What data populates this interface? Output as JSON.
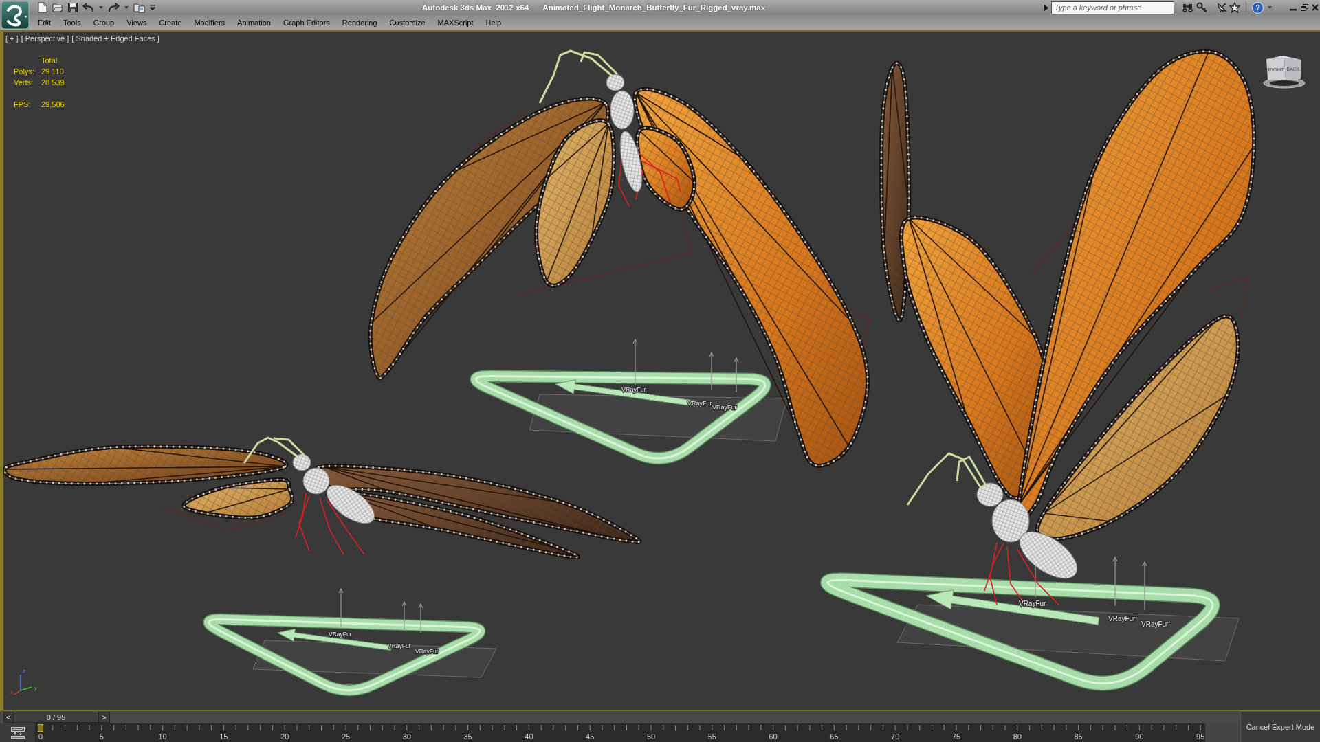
{
  "window": {
    "app_title": "Autodesk 3ds Max  2012 x64",
    "file_name": "Animated_Flight_Monarch_Butterfly_Fur_Rigged_vray.max"
  },
  "search": {
    "placeholder": "Type a keyword or phrase"
  },
  "help_button": "?",
  "menu": [
    "Edit",
    "Tools",
    "Group",
    "Views",
    "Create",
    "Modifiers",
    "Animation",
    "Graph Editors",
    "Rendering",
    "Customize",
    "MAXScript",
    "Help"
  ],
  "viewport": {
    "labels": [
      "[ + ]",
      "[ Perspective ]",
      "[ Shaded + Edged Faces ]"
    ],
    "stats": {
      "header": "Total",
      "rows": [
        {
          "label": "Polys:",
          "value": "29 110"
        },
        {
          "label": "Verts:",
          "value": "28 539"
        }
      ],
      "fps": {
        "label": "FPS:",
        "value": "29,506"
      }
    },
    "fur_helpers": [
      {
        "labels": [
          "VRayFur",
          "VRayFur",
          "VRayFur"
        ]
      },
      {
        "labels": [
          "VRayFur",
          "VRayFur",
          "VRayFur"
        ]
      },
      {
        "labels": [
          "VRayFur",
          "VRayFur",
          "VRayFur"
        ]
      }
    ],
    "view_cube": {
      "faces": [
        "RIGHT",
        "BACK"
      ]
    },
    "axis_labels": [
      "z",
      "x",
      "y"
    ]
  },
  "time_slider": {
    "prev": "<",
    "counter": "0 / 95",
    "next": ">",
    "level": 0
  },
  "trackbar": {
    "labels": [
      "0",
      "5",
      "10",
      "15",
      "20",
      "25",
      "30",
      "35",
      "40",
      "45",
      "50",
      "55",
      "60",
      "65",
      "70",
      "75",
      "80",
      "85",
      "90",
      "95"
    ]
  },
  "expert_mode_button": "Cancel Expert Mode"
}
